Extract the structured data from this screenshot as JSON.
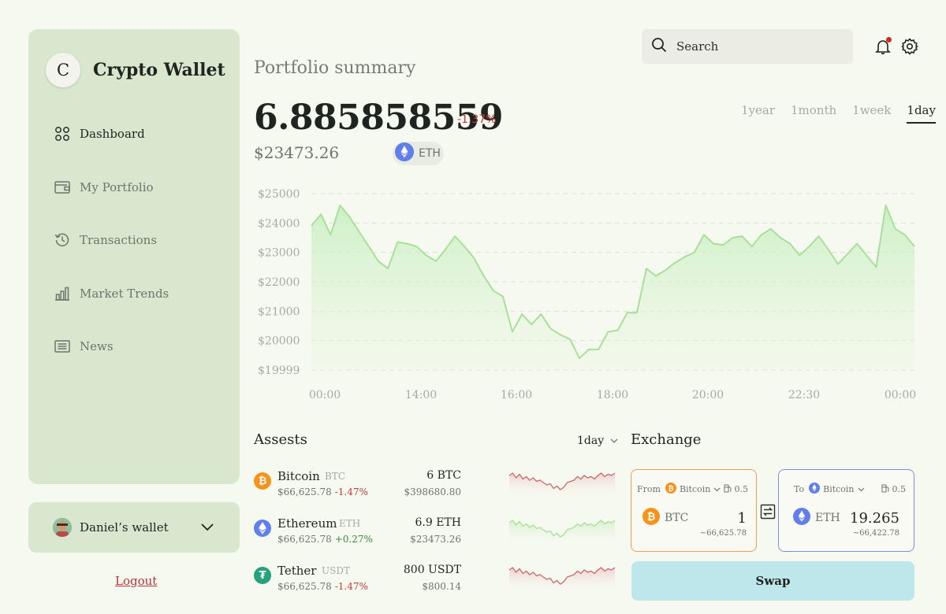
{
  "app": {
    "logo_letter": "C",
    "name": "Crypto Wallet"
  },
  "nav": {
    "items": [
      {
        "label": "Dashboard",
        "icon": "dashboard-icon",
        "active": true
      },
      {
        "label": "My Portfolio",
        "icon": "wallet-icon",
        "active": false
      },
      {
        "label": "Transactions",
        "icon": "history-icon",
        "active": false
      },
      {
        "label": "Market Trends",
        "icon": "bar-chart-icon",
        "active": false
      },
      {
        "label": "News",
        "icon": "news-icon",
        "active": false
      }
    ]
  },
  "wallet": {
    "name": "Daniel’s wallet",
    "logout_label": "Logout"
  },
  "header": {
    "search_placeholder": "Search",
    "has_notification": true
  },
  "portfolio": {
    "title": "Portfolio summary",
    "balance": "6.885858559",
    "change": "-1.37%",
    "usd_value": "$23473.26",
    "coin": "ETH",
    "ranges": [
      "1year",
      "1month",
      "1week",
      "1day"
    ],
    "active_range": "1day"
  },
  "chart_data": {
    "type": "area",
    "title": "",
    "xlabel": "",
    "ylabel": "",
    "ylim": [
      19999,
      25000
    ],
    "y_ticks": [
      "$25000",
      "$24000",
      "$23000",
      "$22000",
      "$21000",
      "$20000",
      "$19999"
    ],
    "y_tick_values": [
      25000,
      24000,
      23000,
      22000,
      21000,
      20000,
      19999
    ],
    "x_ticks": [
      "00:00",
      "14:00",
      "16:00",
      "18:00",
      "20:00",
      "22:30",
      "00:00"
    ],
    "grid": true,
    "color": "#a8e09a",
    "series": [
      {
        "values": [
          23900,
          24300,
          23600,
          24600,
          24200,
          23700,
          23200,
          22700,
          22450,
          23350,
          23300,
          23200,
          22900,
          22700,
          23100,
          23550,
          23200,
          22800,
          22200,
          21700,
          21500,
          20300,
          20900,
          20550,
          20900,
          20400,
          20200,
          20050,
          19400,
          19700,
          19700,
          20300,
          20350,
          20950,
          20950,
          22450,
          22200,
          22400,
          22650,
          22850,
          23000,
          23600,
          23300,
          23250,
          23500,
          23550,
          23200,
          23600,
          23800,
          23500,
          23300,
          22900,
          23200,
          23550,
          23100,
          22600,
          22950,
          23300,
          22900,
          22500,
          24600,
          23800,
          23600,
          23200
        ]
      }
    ]
  },
  "assets": {
    "title": "Assests",
    "filter": "1day",
    "items": [
      {
        "name": "Bitcoin",
        "ticker": "BTC",
        "price": "$66,625.78",
        "change": "-1.47%",
        "trend": "down",
        "amount": "6 BTC",
        "fiat": "$398680.80",
        "icon_color": "#f7931a",
        "icon": "bitcoin-icon"
      },
      {
        "name": "Ethereum",
        "ticker": "ETH",
        "price": "$66,625.78",
        "change": "+0.27%",
        "trend": "up",
        "amount": "6.9 ETH",
        "fiat": "$23473.26",
        "icon_color": "#627eea",
        "icon": "ethereum-icon"
      },
      {
        "name": "Tether",
        "ticker": "USDT",
        "price": "$66,625.78",
        "change": "-1.47%",
        "trend": "down",
        "amount": "800 USDT",
        "fiat": "$800.14",
        "icon_color": "#26a17b",
        "icon": "tether-icon"
      }
    ]
  },
  "exchange": {
    "title": "Exchange",
    "from": {
      "label": "From",
      "coin_select": "Bitcoin",
      "gas": "0.5",
      "coin": "BTC",
      "amount": "1",
      "approx": "~66,625.78"
    },
    "to": {
      "label": "To",
      "coin_select": "Bitcoin",
      "gas": "0.5",
      "coin": "ETH",
      "amount": "19.265",
      "approx": "~66,422.78"
    },
    "swap_label": "Swap"
  }
}
